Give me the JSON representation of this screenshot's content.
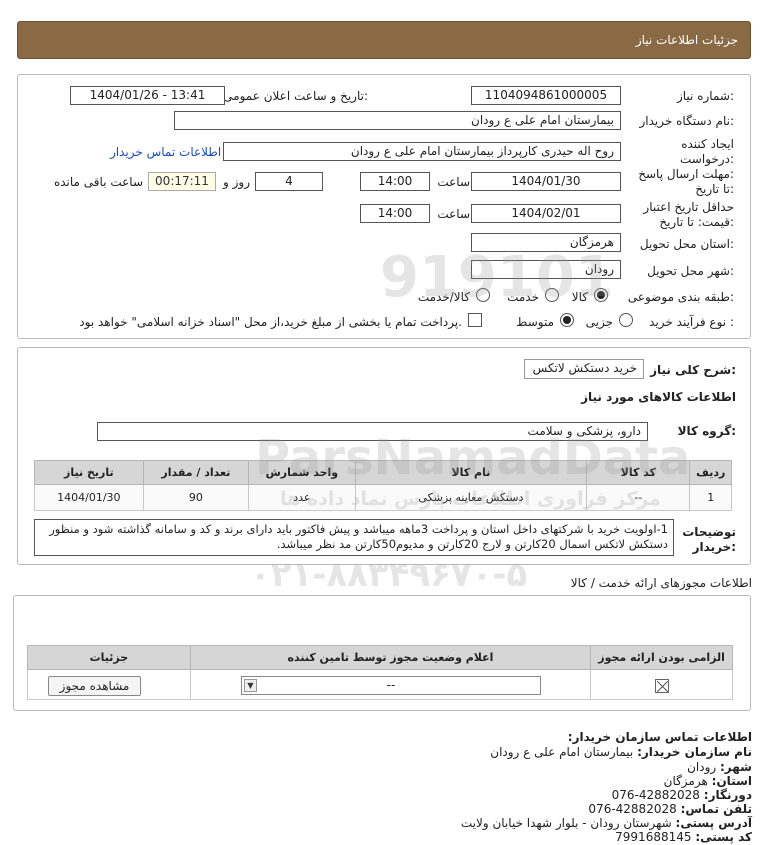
{
  "header": {
    "title": "جزئیات اطلاعات نیاز"
  },
  "form": {
    "need_number_label": "شماره نیاز:",
    "need_number": "1104094861000005",
    "announce_label": "تاریخ و ساعت اعلان عمومی:",
    "announce_value": "1404/01/26 - 13:41",
    "buyer_label": "نام دستگاه خریدار:",
    "buyer_value": "بیمارستان امام علی  ع  رودان",
    "creator_label_1": "ایجاد کننده",
    "creator_label_2": "درخواست:",
    "creator_value": "روح اله حیدری کارپرداز  بیمارستان امام علی  ع  رودان",
    "contact_link": "اطلاعات تماس خریدار",
    "deadline_label_1": "مهلت ارسال پاسخ:",
    "deadline_label_2": "تا تاریخ:",
    "deadline_date": "1404/01/30",
    "time_label": "ساعت",
    "deadline_time": "14:00",
    "days_value": "4",
    "days_label": "روز و",
    "remaining_time": "00:17:11",
    "remaining_label": "ساعت باقی مانده",
    "validity_label_1": "حداقل تاریخ اعتبار",
    "validity_label_2": "قیمت: تا تاریخ:",
    "validity_date": "1404/02/01",
    "validity_time": "14:00",
    "province_label": "استان محل تحویل:",
    "province_value": "هرمزگان",
    "city_label": "شهر محل تحویل:",
    "city_value": "رودان",
    "category_label": "طبقه بندی موضوعی:",
    "category_options": [
      "کالا",
      "خدمت",
      "کالا/خدمت"
    ],
    "category_selected": "کالا",
    "process_label": "نوع فرآیند خرید :",
    "process_options": [
      "جزیی",
      "متوسط"
    ],
    "process_selected": "متوسط",
    "payment_note": "پرداخت تمام یا بخشی از مبلغ خرید،از محل \"اسناد خزانه اسلامی\" خواهد بود."
  },
  "details": {
    "summary_label": "شرح کلی نیاز:",
    "summary_value": "خرید دستکش لاتکس",
    "goods_info_title": "اطلاعات کالاهای مورد نیاز",
    "group_label": "گروه کالا:",
    "group_value": "دارو، پزشکی و سلامت",
    "table_headers": [
      "ردیف",
      "کد کالا",
      "نام کالا",
      "واحد شمارش",
      "تعداد / مقدار",
      "تاریخ نیاز"
    ],
    "rows": [
      {
        "row": "1",
        "code": "--",
        "name": "دستکش معاینه پزشکی",
        "unit": "عدد",
        "qty": "90",
        "date": "1404/01/30"
      }
    ],
    "notes_label_1": "توضیحات",
    "notes_label_2": "خریدار:",
    "notes_text": "1-اولویت خرید با شرکتهای داخل استان و پرداخت 3ماهه میباشد و پیش فاکتور باید دارای برند و کد و سامانه گذاشته شود و منظور دستکش لاتکس اسمال 20کارتن و لارج 20کارتن و مدیوم50کارتن مد نظر میباشد."
  },
  "permits": {
    "title": "اطلاعات مجوزهای ارائه خدمت / کالا",
    "headers": [
      "الزامی بودن ارائه مجوز",
      "اعلام وضعیت مجوز توسط تامین کننده",
      "جزئیات"
    ],
    "select_value": "--",
    "view_button": "مشاهده مجوز"
  },
  "contact": {
    "title": "اطلاعات تماس سازمان خریدار:",
    "org_label": "نام سازمان خریدار:",
    "org_value": "بیمارستان امام علی ع رودان",
    "city_label": "شهر:",
    "city_value": "رودان",
    "province_label": "استان:",
    "province_value": "هرمزگان",
    "fax_label": "دورنگار:",
    "fax_value": "076-42882028",
    "phone_label": "تلفن تماس:",
    "phone_value": "076-42882028",
    "address_label": "آدرس پستی:",
    "address_value": "شهرستان رودان - بلوار شهدا خیابان ولایت",
    "postal_label": "کد پستی:",
    "postal_value": "7991688145"
  },
  "watermark": {
    "line1": "ParsNamadData",
    "line2": "مرکز فراوری اطلاعات پارس نماد داده ها",
    "phone": "۰۲۱-۸۸۳۴۹۶۷۰-۵",
    "code": "919101"
  },
  "colors": {
    "header_bg": "#8a6a45",
    "link": "#1a4db3",
    "table_header": "#d6d6d6"
  }
}
